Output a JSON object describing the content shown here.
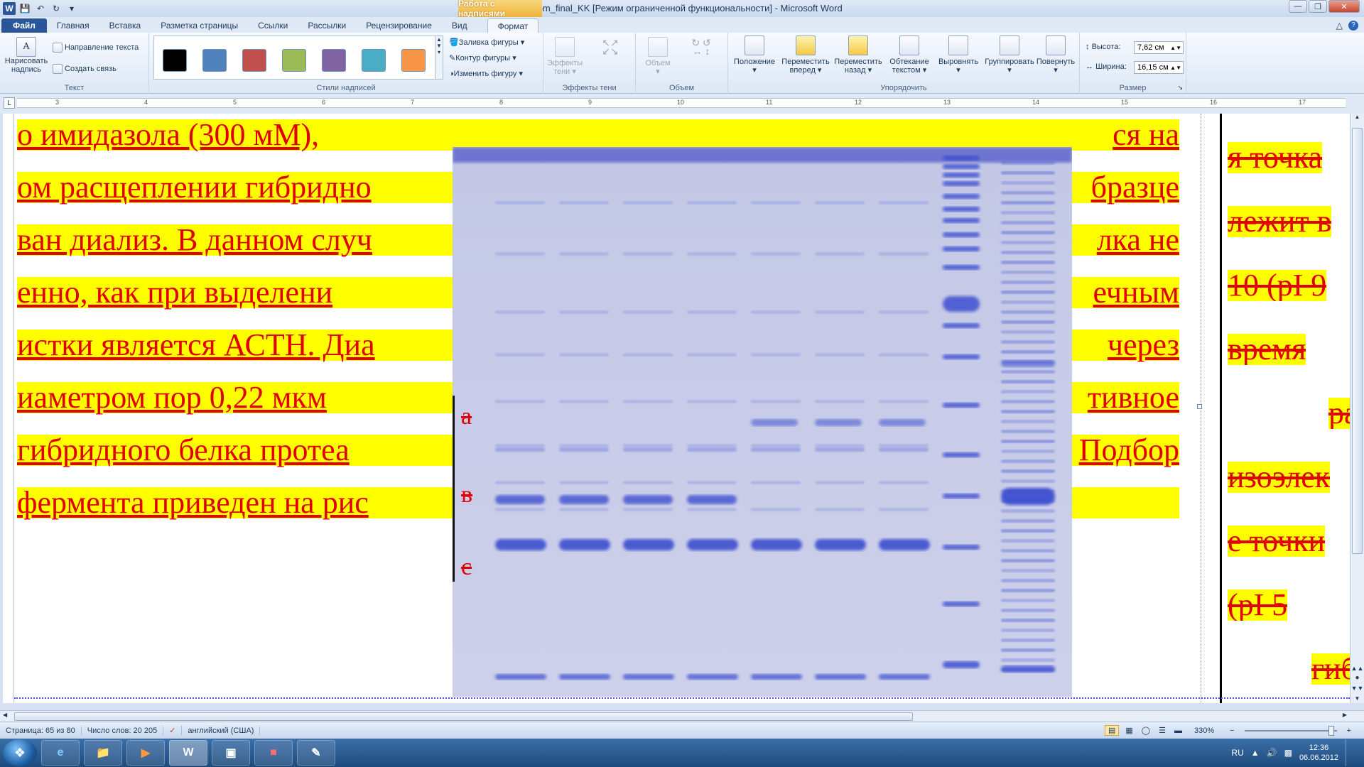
{
  "window": {
    "title": "Diplom_final_KK [Режим ограниченной функциональности]  -  Microsoft Word",
    "context_tab_title": "Работа с надписями"
  },
  "tabs": [
    "Файл",
    "Главная",
    "Вставка",
    "Разметка страницы",
    "Ссылки",
    "Рассылки",
    "Рецензирование",
    "Вид",
    "Формат"
  ],
  "active_tab": "Формат",
  "ribbon": {
    "text_group": {
      "label": "Текст",
      "draw_textbox": "Нарисовать надпись",
      "text_direction": "Направление текста",
      "create_link": "Создать связь"
    },
    "styles_group": {
      "label": "Стили надписей",
      "swatches": [
        "#000000",
        "#4f81bd",
        "#c0504d",
        "#9bbb59",
        "#8064a2",
        "#4bacc6",
        "#f79646"
      ],
      "shape_fill": "Заливка фигуры",
      "shape_outline": "Контур фигуры",
      "change_shape": "Изменить фигуру"
    },
    "shadow_group": {
      "label": "Эффекты тени",
      "button": "Эффекты тени"
    },
    "volume_group": {
      "label": "Объем",
      "button": "Объем"
    },
    "arrange_group": {
      "label": "Упорядочить",
      "position": "Положение",
      "bring_forward": "Переместить вперед",
      "send_backward": "Переместить назад",
      "wrap_text": "Обтекание текстом",
      "align": "Выровнять",
      "group": "Группировать",
      "rotate": "Повернуть"
    },
    "size_group": {
      "label": "Размер",
      "height_label": "Высота:",
      "height_value": "7,62 см",
      "width_label": "Ширина:",
      "width_value": "16,15 см"
    }
  },
  "ruler": {
    "marks": [
      "3",
      "4",
      "5",
      "6",
      "7",
      "8",
      "9",
      "10",
      "11",
      "12",
      "13",
      "14",
      "15",
      "16",
      "17"
    ]
  },
  "document": {
    "lines": [
      "о  имидазола  (300  мМ),",
      "ом расщеплении гибридно",
      "ван диализ. В данном случ",
      "енно,  как  при  выделени",
      "истки является АСТН. Диа",
      "иаметром  пор  0,22  мкм",
      " гибридного  белка  протеа",
      " фермента приведен на рис"
    ],
    "lines_right": [
      "ся   на",
      "бразце",
      "лка  не",
      "ечным",
      "  через",
      "тивное",
      "Подбор",
      ""
    ],
    "right_column": [
      "я   точка",
      "лежит   в",
      "10 (pI 9",
      "время",
      "ра",
      "изоэлек",
      "е  точки",
      "(pI       5",
      "гиб"
    ],
    "gel_labels": [
      "a",
      "в",
      "c"
    ],
    "gel_colors": {
      "background": "#c9cde8",
      "band": "#3d4fd0",
      "top": "#5a5fc8"
    }
  },
  "status": {
    "page": "Страница: 65 из 80",
    "words": "Число слов: 20 205",
    "language": "английский (США)",
    "zoom": "330%"
  },
  "taskbar": {
    "lang": "RU",
    "time": "12:36",
    "date": "06.06.2012"
  }
}
